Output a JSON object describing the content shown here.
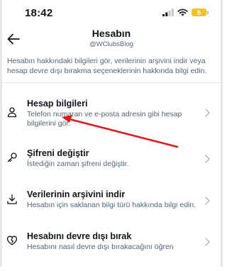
{
  "status_bar": {
    "time": "18:42",
    "battery": "5"
  },
  "header": {
    "title": "Hesabın",
    "subtitle": "@WClubsBlog"
  },
  "description": "Hesabın hakkındaki bilgileri gör, verilerinin arşivini indir veya hesap devre dışı bırakma seçeneklerinin hakkında bilgi edin.",
  "items": [
    {
      "icon": "person-icon",
      "title": "Hesap bilgileri",
      "desc": "Telefon numaran ve e-posta adresin gibi hesap bilgilerini gör."
    },
    {
      "icon": "key-icon",
      "title": "Şifreni değiştir",
      "desc": "İstediğin zaman şifreni değiştir."
    },
    {
      "icon": "download-icon",
      "title": "Verilerinin arşivini indir",
      "desc": "Hesabın için saklanan bilgi türü hakkında bilgi edin."
    },
    {
      "icon": "broken-heart-icon",
      "title": "Hesabını devre dışı bırak",
      "desc": "Hesabını nasıl devre dışı bırakacağını öğren"
    }
  ],
  "colors": {
    "annotation_arrow": "#e0181b",
    "battery": "#f0c51a"
  }
}
